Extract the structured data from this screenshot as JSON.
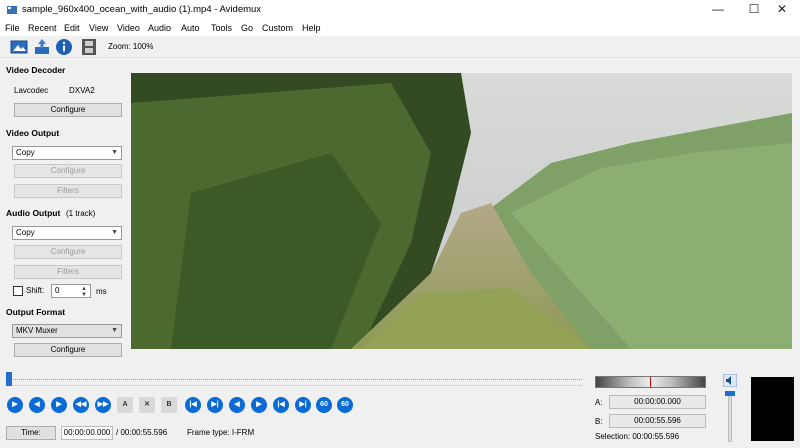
{
  "window": {
    "title": "sample_960x400_ocean_with_audio (1).mp4 - Avidemux",
    "minimize": "—",
    "maximize": "☐",
    "close": "✕"
  },
  "menu": [
    "File",
    "Recent",
    "Edit",
    "View",
    "Video",
    "Audio",
    "Auto",
    "Tools",
    "Go",
    "Custom",
    "Help"
  ],
  "toolbar": {
    "zoom": "Zoom: 100%"
  },
  "left_panel": {
    "video_decoder": {
      "title": "Video Decoder",
      "codec_label": "Lavcodec",
      "codec_value": "DXVA2",
      "configure": "Configure"
    },
    "video_output": {
      "title": "Video Output",
      "codec": "Copy",
      "configure": "Configure",
      "filters": "Filters"
    },
    "audio_output": {
      "title": "Audio Output",
      "tracks": "(1 track)",
      "codec": "Copy",
      "configure": "Configure",
      "filters": "Filters",
      "shift_label": "Shift:",
      "shift_value": "0",
      "shift_unit": "ms"
    },
    "output_format": {
      "title": "Output Format",
      "muxer": "MKV Muxer",
      "configure": "Configure"
    }
  },
  "playback": {
    "position_fraction": 0.0,
    "controls": [
      {
        "name": "play-icon",
        "glyph": "▶"
      },
      {
        "name": "previous-frame-icon",
        "glyph": "◀"
      },
      {
        "name": "next-frame-icon",
        "glyph": "▶"
      },
      {
        "name": "rewind-icon",
        "glyph": "◀◀"
      },
      {
        "name": "fast-forward-icon",
        "glyph": "▶▶"
      },
      {
        "name": "set-marker-a-icon",
        "glyph": "A"
      },
      {
        "name": "clear-markers-icon",
        "glyph": "✕"
      },
      {
        "name": "set-marker-b-icon",
        "glyph": "B"
      },
      {
        "name": "previous-keyframe-icon",
        "glyph": "|◀"
      },
      {
        "name": "next-keyframe-icon",
        "glyph": "▶|"
      },
      {
        "name": "previous-black-frame-icon",
        "glyph": "◀"
      },
      {
        "name": "next-black-frame-icon",
        "glyph": "▶"
      },
      {
        "name": "goto-start-icon",
        "glyph": "|◀"
      },
      {
        "name": "goto-end-icon",
        "glyph": "▶|"
      },
      {
        "name": "back-60s-icon",
        "glyph": "60"
      },
      {
        "name": "forward-60s-icon",
        "glyph": "60"
      }
    ]
  },
  "status": {
    "time_button": "Time:",
    "current_time": "00:00:00.000",
    "total_time": "/ 00:00:55.596",
    "frame_type": "Frame type:  I-FRM"
  },
  "markers": {
    "a_label": "A:",
    "a_value": "00:00:00.000",
    "b_label": "B:",
    "b_value": "00:00:55.596",
    "selection": "Selection: 00:00:55.596"
  },
  "colors": {
    "accent": "#0a6ad6",
    "window_bg": "#f0f0f0"
  }
}
